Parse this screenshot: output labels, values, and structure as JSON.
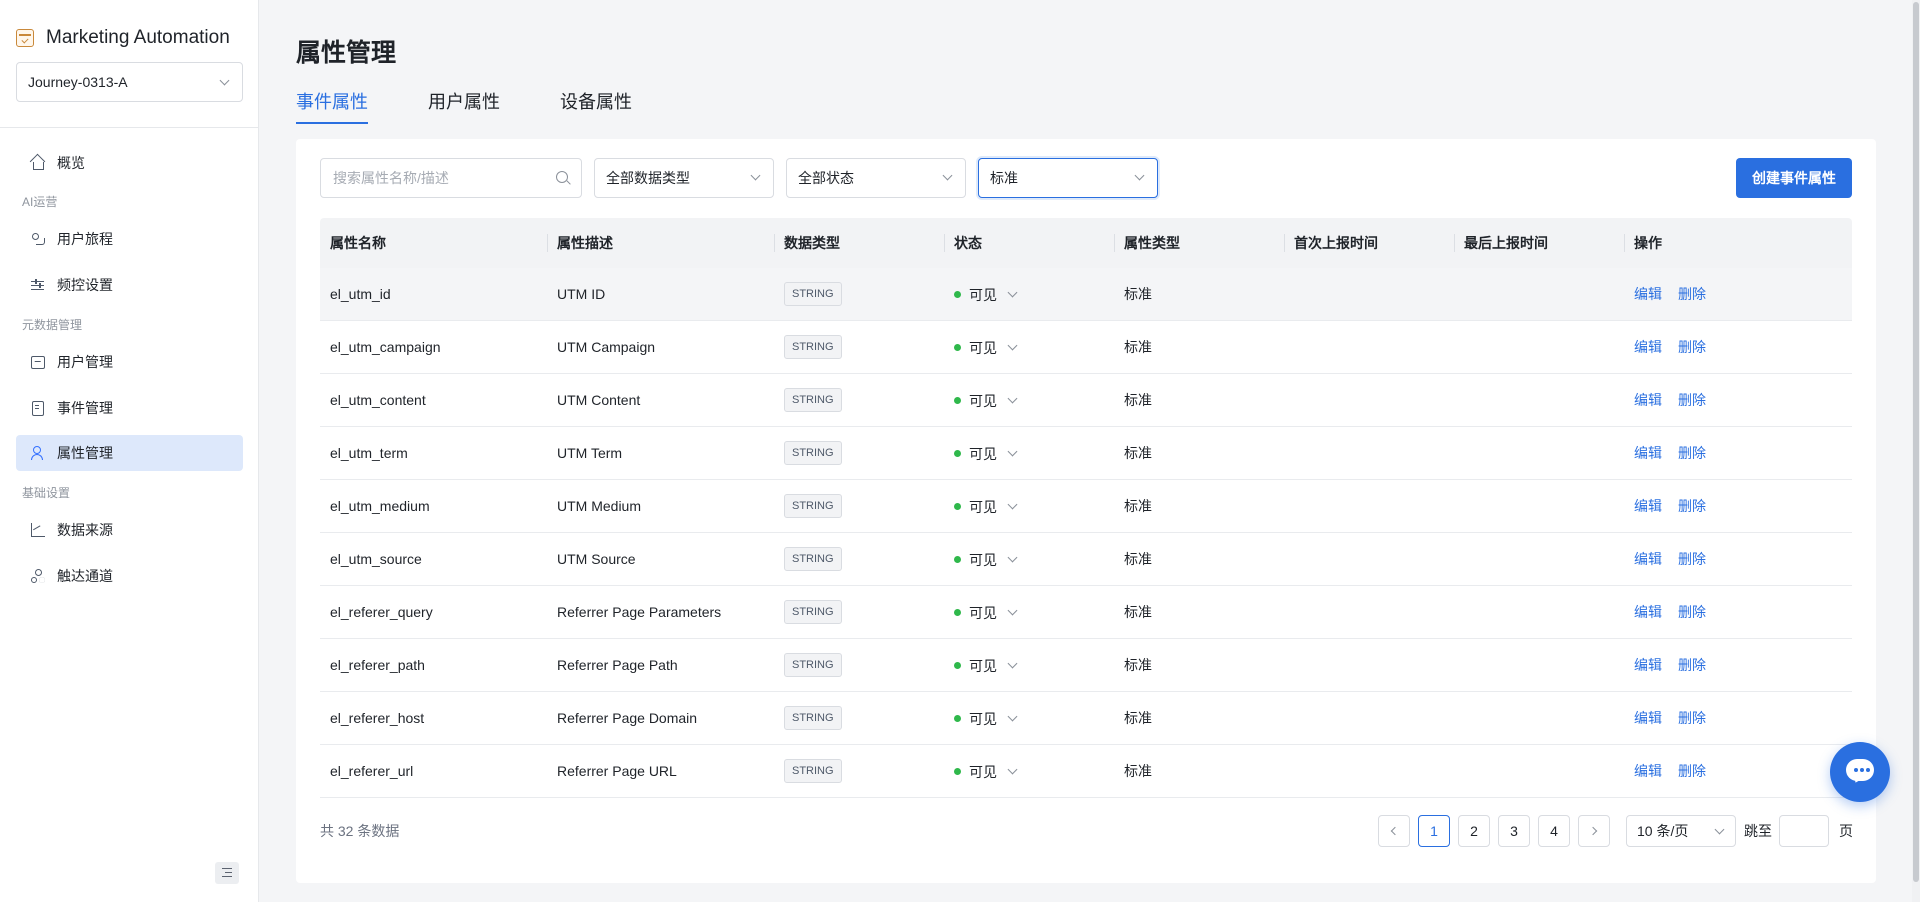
{
  "app": {
    "title": "Marketing Automation",
    "journey_select": "Journey-0313-A"
  },
  "sidebar": {
    "overview": "概览",
    "section_ai": "AI运营",
    "journey": "用户旅程",
    "frequency": "频控设置",
    "section_meta": "元数据管理",
    "users": "用户管理",
    "events": "事件管理",
    "attributes": "属性管理",
    "section_base": "基础设置",
    "data_source": "数据来源",
    "reach": "触达通道"
  },
  "page": {
    "title": "属性管理"
  },
  "tabs": [
    {
      "label": "事件属性",
      "active": true
    },
    {
      "label": "用户属性",
      "active": false
    },
    {
      "label": "设备属性",
      "active": false
    }
  ],
  "toolbar": {
    "search_placeholder": "搜索属性名称/描述",
    "data_type_filter": "全部数据类型",
    "status_filter": "全部状态",
    "attr_type_filter": "标准",
    "create_button": "创建事件属性"
  },
  "table": {
    "columns": [
      "属性名称",
      "属性描述",
      "数据类型",
      "状态",
      "属性类型",
      "首次上报时间",
      "最后上报时间",
      "操作"
    ],
    "edit_label": "编辑",
    "delete_label": "删除",
    "status_color": "#2fb84b",
    "rows": [
      {
        "name": "el_utm_id",
        "desc": "UTM ID",
        "type": "STRING",
        "status": "可见",
        "attr_type": "标准",
        "first": "",
        "last": ""
      },
      {
        "name": "el_utm_campaign",
        "desc": "UTM Campaign",
        "type": "STRING",
        "status": "可见",
        "attr_type": "标准",
        "first": "",
        "last": ""
      },
      {
        "name": "el_utm_content",
        "desc": "UTM Content",
        "type": "STRING",
        "status": "可见",
        "attr_type": "标准",
        "first": "",
        "last": ""
      },
      {
        "name": "el_utm_term",
        "desc": "UTM Term",
        "type": "STRING",
        "status": "可见",
        "attr_type": "标准",
        "first": "",
        "last": ""
      },
      {
        "name": "el_utm_medium",
        "desc": "UTM Medium",
        "type": "STRING",
        "status": "可见",
        "attr_type": "标准",
        "first": "",
        "last": ""
      },
      {
        "name": "el_utm_source",
        "desc": "UTM Source",
        "type": "STRING",
        "status": "可见",
        "attr_type": "标准",
        "first": "",
        "last": ""
      },
      {
        "name": "el_referer_query",
        "desc": "Referrer Page Parameters",
        "type": "STRING",
        "status": "可见",
        "attr_type": "标准",
        "first": "",
        "last": ""
      },
      {
        "name": "el_referer_path",
        "desc": "Referrer Page Path",
        "type": "STRING",
        "status": "可见",
        "attr_type": "标准",
        "first": "",
        "last": ""
      },
      {
        "name": "el_referer_host",
        "desc": "Referrer Page Domain",
        "type": "STRING",
        "status": "可见",
        "attr_type": "标准",
        "first": "",
        "last": ""
      },
      {
        "name": "el_referer_url",
        "desc": "Referrer Page URL",
        "type": "STRING",
        "status": "可见",
        "attr_type": "标准",
        "first": "",
        "last": ""
      }
    ]
  },
  "pagination": {
    "total": "共 32 条数据",
    "pages": [
      "1",
      "2",
      "3",
      "4"
    ],
    "current": "1",
    "page_size": "10 条/页",
    "jump_label": "跳至",
    "page_unit": "页"
  },
  "colors": {
    "accent": "#2a6fe0",
    "active_nav_bg": "#dde8fb"
  }
}
